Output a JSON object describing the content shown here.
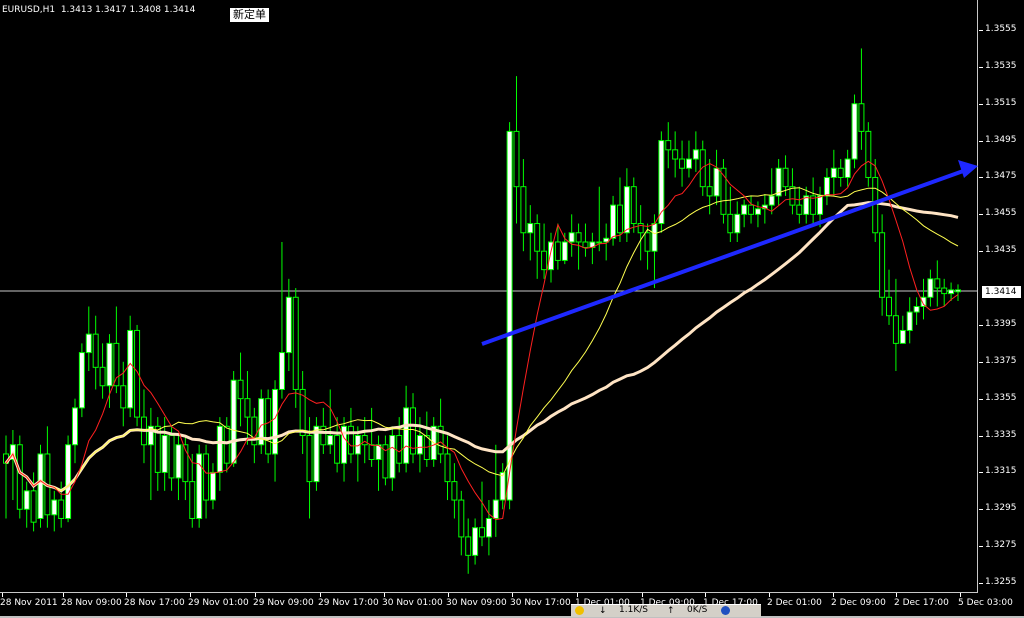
{
  "window": {
    "symbol_info": "EURUSD,H1  1.3413 1.3417 1.3408 1.3414",
    "new_order_tooltip": "新定单"
  },
  "price_axis": {
    "labels": [
      "1.3555",
      "1.3535",
      "1.3515",
      "1.3495",
      "1.3475",
      "1.3455",
      "1.3435",
      "1.3414",
      "1.3395",
      "1.3375",
      "1.3355",
      "1.3335",
      "1.3315",
      "1.3295",
      "1.3275",
      "1.3255"
    ],
    "current_price": "1.3414"
  },
  "time_axis": {
    "labels": [
      "28 Nov 2011",
      "28 Nov 09:00",
      "28 Nov 17:00",
      "29 Nov 01:00",
      "29 Nov 09:00",
      "29 Nov 17:00",
      "30 Nov 01:00",
      "30 Nov 09:00",
      "30 Nov 17:00",
      "1 Dec 01:00",
      "1 Dec 09:00",
      "1 Dec 17:00",
      "2 Dec 01:00",
      "2 Dec 09:00",
      "2 Dec 17:00",
      "5 Dec 03:00"
    ]
  },
  "statusbar": {
    "traffic_in": "1.1K/S",
    "traffic_out": "0K/S"
  },
  "colors": {
    "background": "#000000",
    "candle": "#00ff00",
    "bull_body": "#ffffff",
    "bear_body": "#000000",
    "ma_fast": "#ff2020",
    "ma_mid": "#ffff50",
    "ma_slow": "#ffe4c4",
    "trendline": "#1e28ff",
    "grid_line": "#c8c8c8"
  },
  "chart_data": {
    "type": "candlestick",
    "symbol": "EURUSD",
    "timeframe": "H1",
    "ylim": [
      1.3245,
      1.3565
    ],
    "last_bar": {
      "open": 1.3413,
      "high": 1.3417,
      "low": 1.3408,
      "close": 1.3414
    },
    "candles": [
      [
        1.3325,
        1.3335,
        1.329,
        1.332
      ],
      [
        1.3322,
        1.3338,
        1.33,
        1.333
      ],
      [
        1.333,
        1.3335,
        1.329,
        1.3295
      ],
      [
        1.3295,
        1.331,
        1.3285,
        1.3305
      ],
      [
        1.3305,
        1.3315,
        1.3283,
        1.3288
      ],
      [
        1.329,
        1.333,
        1.3285,
        1.3325
      ],
      [
        1.3325,
        1.334,
        1.3285,
        1.3292
      ],
      [
        1.3292,
        1.3305,
        1.3283,
        1.33
      ],
      [
        1.33,
        1.331,
        1.3285,
        1.329
      ],
      [
        1.329,
        1.3335,
        1.3288,
        1.333
      ],
      [
        1.333,
        1.3355,
        1.332,
        1.335
      ],
      [
        1.335,
        1.3385,
        1.3345,
        1.338
      ],
      [
        1.338,
        1.3405,
        1.337,
        1.339
      ],
      [
        1.339,
        1.34,
        1.336,
        1.3372
      ],
      [
        1.3372,
        1.3385,
        1.3355,
        1.3362
      ],
      [
        1.3362,
        1.339,
        1.335,
        1.3385
      ],
      [
        1.3385,
        1.3405,
        1.3358,
        1.3362
      ],
      [
        1.3362,
        1.3375,
        1.334,
        1.335
      ],
      [
        1.335,
        1.34,
        1.3345,
        1.3392
      ],
      [
        1.3392,
        1.3395,
        1.334,
        1.3345
      ],
      [
        1.3345,
        1.336,
        1.332,
        1.333
      ],
      [
        1.333,
        1.335,
        1.33,
        1.334
      ],
      [
        1.334,
        1.3345,
        1.3305,
        1.3315
      ],
      [
        1.3315,
        1.3345,
        1.3305,
        1.3335
      ],
      [
        1.3335,
        1.334,
        1.3305,
        1.3312
      ],
      [
        1.3312,
        1.3335,
        1.33,
        1.333
      ],
      [
        1.333,
        1.3335,
        1.33,
        1.331
      ],
      [
        1.331,
        1.3325,
        1.3285,
        1.329
      ],
      [
        1.329,
        1.333,
        1.3285,
        1.3325
      ],
      [
        1.3325,
        1.333,
        1.329,
        1.33
      ],
      [
        1.33,
        1.332,
        1.3295,
        1.3315
      ],
      [
        1.3315,
        1.3345,
        1.3305,
        1.334
      ],
      [
        1.334,
        1.3345,
        1.3315,
        1.332
      ],
      [
        1.332,
        1.337,
        1.3318,
        1.3365
      ],
      [
        1.3365,
        1.338,
        1.334,
        1.3355
      ],
      [
        1.3355,
        1.337,
        1.333,
        1.3345
      ],
      [
        1.3345,
        1.335,
        1.332,
        1.333
      ],
      [
        1.333,
        1.336,
        1.3325,
        1.3355
      ],
      [
        1.3355,
        1.336,
        1.332,
        1.3325
      ],
      [
        1.3325,
        1.3365,
        1.331,
        1.336
      ],
      [
        1.336,
        1.344,
        1.3355,
        1.338
      ],
      [
        1.338,
        1.342,
        1.337,
        1.341
      ],
      [
        1.341,
        1.3415,
        1.335,
        1.336
      ],
      [
        1.336,
        1.337,
        1.3325,
        1.3335
      ],
      [
        1.3335,
        1.3345,
        1.329,
        1.331
      ],
      [
        1.331,
        1.3345,
        1.3305,
        1.334
      ],
      [
        1.334,
        1.335,
        1.3325,
        1.333
      ],
      [
        1.333,
        1.336,
        1.3325,
        1.3335
      ],
      [
        1.3335,
        1.3345,
        1.3315,
        1.332
      ],
      [
        1.332,
        1.3345,
        1.331,
        1.334
      ],
      [
        1.334,
        1.335,
        1.332,
        1.3325
      ],
      [
        1.3325,
        1.334,
        1.331,
        1.3335
      ],
      [
        1.3335,
        1.3345,
        1.332,
        1.333
      ],
      [
        1.333,
        1.335,
        1.3318,
        1.3322
      ],
      [
        1.3322,
        1.3335,
        1.3305,
        1.333
      ],
      [
        1.333,
        1.3335,
        1.3308,
        1.3312
      ],
      [
        1.3312,
        1.334,
        1.3305,
        1.3335
      ],
      [
        1.3335,
        1.3345,
        1.3315,
        1.332
      ],
      [
        1.332,
        1.3362,
        1.3315,
        1.335
      ],
      [
        1.335,
        1.3358,
        1.332,
        1.3325
      ],
      [
        1.3325,
        1.3345,
        1.3315,
        1.3335
      ],
      [
        1.3335,
        1.3348,
        1.3318,
        1.3322
      ],
      [
        1.3322,
        1.3345,
        1.3318,
        1.334
      ],
      [
        1.334,
        1.3355,
        1.332,
        1.3325
      ],
      [
        1.3325,
        1.3335,
        1.33,
        1.331
      ],
      [
        1.331,
        1.332,
        1.329,
        1.33
      ],
      [
        1.33,
        1.3305,
        1.327,
        1.328
      ],
      [
        1.328,
        1.329,
        1.326,
        1.327
      ],
      [
        1.327,
        1.329,
        1.3265,
        1.3285
      ],
      [
        1.3285,
        1.331,
        1.3275,
        1.328
      ],
      [
        1.328,
        1.33,
        1.327,
        1.329
      ],
      [
        1.329,
        1.333,
        1.328,
        1.33
      ],
      [
        1.33,
        1.332,
        1.3295,
        1.3315
      ],
      [
        1.33,
        1.3505,
        1.3295,
        1.35
      ],
      [
        1.35,
        1.353,
        1.345,
        1.347
      ],
      [
        1.347,
        1.3485,
        1.3435,
        1.3445
      ],
      [
        1.3445,
        1.346,
        1.343,
        1.345
      ],
      [
        1.345,
        1.3455,
        1.342,
        1.3435
      ],
      [
        1.3435,
        1.345,
        1.342,
        1.3425
      ],
      [
        1.3425,
        1.3445,
        1.3418,
        1.344
      ],
      [
        1.344,
        1.345,
        1.3425,
        1.343
      ],
      [
        1.343,
        1.3445,
        1.3428,
        1.344
      ],
      [
        1.344,
        1.3455,
        1.3432,
        1.3445
      ],
      [
        1.3445,
        1.345,
        1.3425,
        1.344
      ],
      [
        1.344,
        1.345,
        1.3432,
        1.3437
      ],
      [
        1.3437,
        1.3445,
        1.3428,
        1.344
      ],
      [
        1.344,
        1.347,
        1.3435,
        1.344
      ],
      [
        1.344,
        1.345,
        1.343,
        1.3442
      ],
      [
        1.3442,
        1.3465,
        1.3438,
        1.346
      ],
      [
        1.346,
        1.3475,
        1.344,
        1.3445
      ],
      [
        1.3445,
        1.348,
        1.344,
        1.347
      ],
      [
        1.347,
        1.3475,
        1.3445,
        1.345
      ],
      [
        1.345,
        1.346,
        1.343,
        1.3445
      ],
      [
        1.3445,
        1.345,
        1.3425,
        1.3435
      ],
      [
        1.3435,
        1.3455,
        1.3415,
        1.345
      ],
      [
        1.345,
        1.35,
        1.3445,
        1.3495
      ],
      [
        1.3495,
        1.3505,
        1.348,
        1.349
      ],
      [
        1.349,
        1.35,
        1.3475,
        1.3485
      ],
      [
        1.3485,
        1.3495,
        1.347,
        1.348
      ],
      [
        1.348,
        1.3495,
        1.3475,
        1.3485
      ],
      [
        1.3485,
        1.35,
        1.3478,
        1.349
      ],
      [
        1.349,
        1.3495,
        1.3465,
        1.347
      ],
      [
        1.347,
        1.3485,
        1.3455,
        1.3465
      ],
      [
        1.3465,
        1.349,
        1.346,
        1.348
      ],
      [
        1.348,
        1.3485,
        1.345,
        1.3455
      ],
      [
        1.3455,
        1.347,
        1.344,
        1.3445
      ],
      [
        1.3445,
        1.3462,
        1.344,
        1.3455
      ],
      [
        1.3455,
        1.3463,
        1.3448,
        1.346
      ],
      [
        1.346,
        1.3465,
        1.345,
        1.3455
      ],
      [
        1.3455,
        1.3462,
        1.3448,
        1.3458
      ],
      [
        1.3458,
        1.3466,
        1.345,
        1.346
      ],
      [
        1.346,
        1.348,
        1.3455,
        1.3465
      ],
      [
        1.3465,
        1.3485,
        1.346,
        1.348
      ],
      [
        1.348,
        1.3487,
        1.3465,
        1.347
      ],
      [
        1.347,
        1.348,
        1.3455,
        1.346
      ],
      [
        1.346,
        1.347,
        1.345,
        1.3455
      ],
      [
        1.3455,
        1.347,
        1.345,
        1.3465
      ],
      [
        1.3465,
        1.3475,
        1.345,
        1.3455
      ],
      [
        1.3455,
        1.347,
        1.3448,
        1.3465
      ],
      [
        1.3465,
        1.348,
        1.346,
        1.3475
      ],
      [
        1.3475,
        1.349,
        1.3465,
        1.348
      ],
      [
        1.348,
        1.3485,
        1.347,
        1.3475
      ],
      [
        1.3475,
        1.349,
        1.347,
        1.3485
      ],
      [
        1.3485,
        1.352,
        1.348,
        1.3515
      ],
      [
        1.3515,
        1.3545,
        1.349,
        1.35
      ],
      [
        1.35,
        1.3505,
        1.347,
        1.3475
      ],
      [
        1.3475,
        1.3485,
        1.344,
        1.3445
      ],
      [
        1.3445,
        1.3455,
        1.34,
        1.341
      ],
      [
        1.341,
        1.3425,
        1.3395,
        1.34
      ],
      [
        1.34,
        1.342,
        1.337,
        1.3385
      ],
      [
        1.3385,
        1.34,
        1.3385,
        1.3392
      ],
      [
        1.3392,
        1.341,
        1.3385,
        1.3402
      ],
      [
        1.3402,
        1.341,
        1.3395,
        1.3405
      ],
      [
        1.3405,
        1.342,
        1.3398,
        1.341
      ],
      [
        1.341,
        1.3425,
        1.3405,
        1.342
      ],
      [
        1.342,
        1.343,
        1.3405,
        1.3415
      ],
      [
        1.3415,
        1.342,
        1.3405,
        1.3412
      ],
      [
        1.3412,
        1.3418,
        1.3408,
        1.3414
      ],
      [
        1.3413,
        1.3417,
        1.3408,
        1.3414
      ]
    ]
  }
}
